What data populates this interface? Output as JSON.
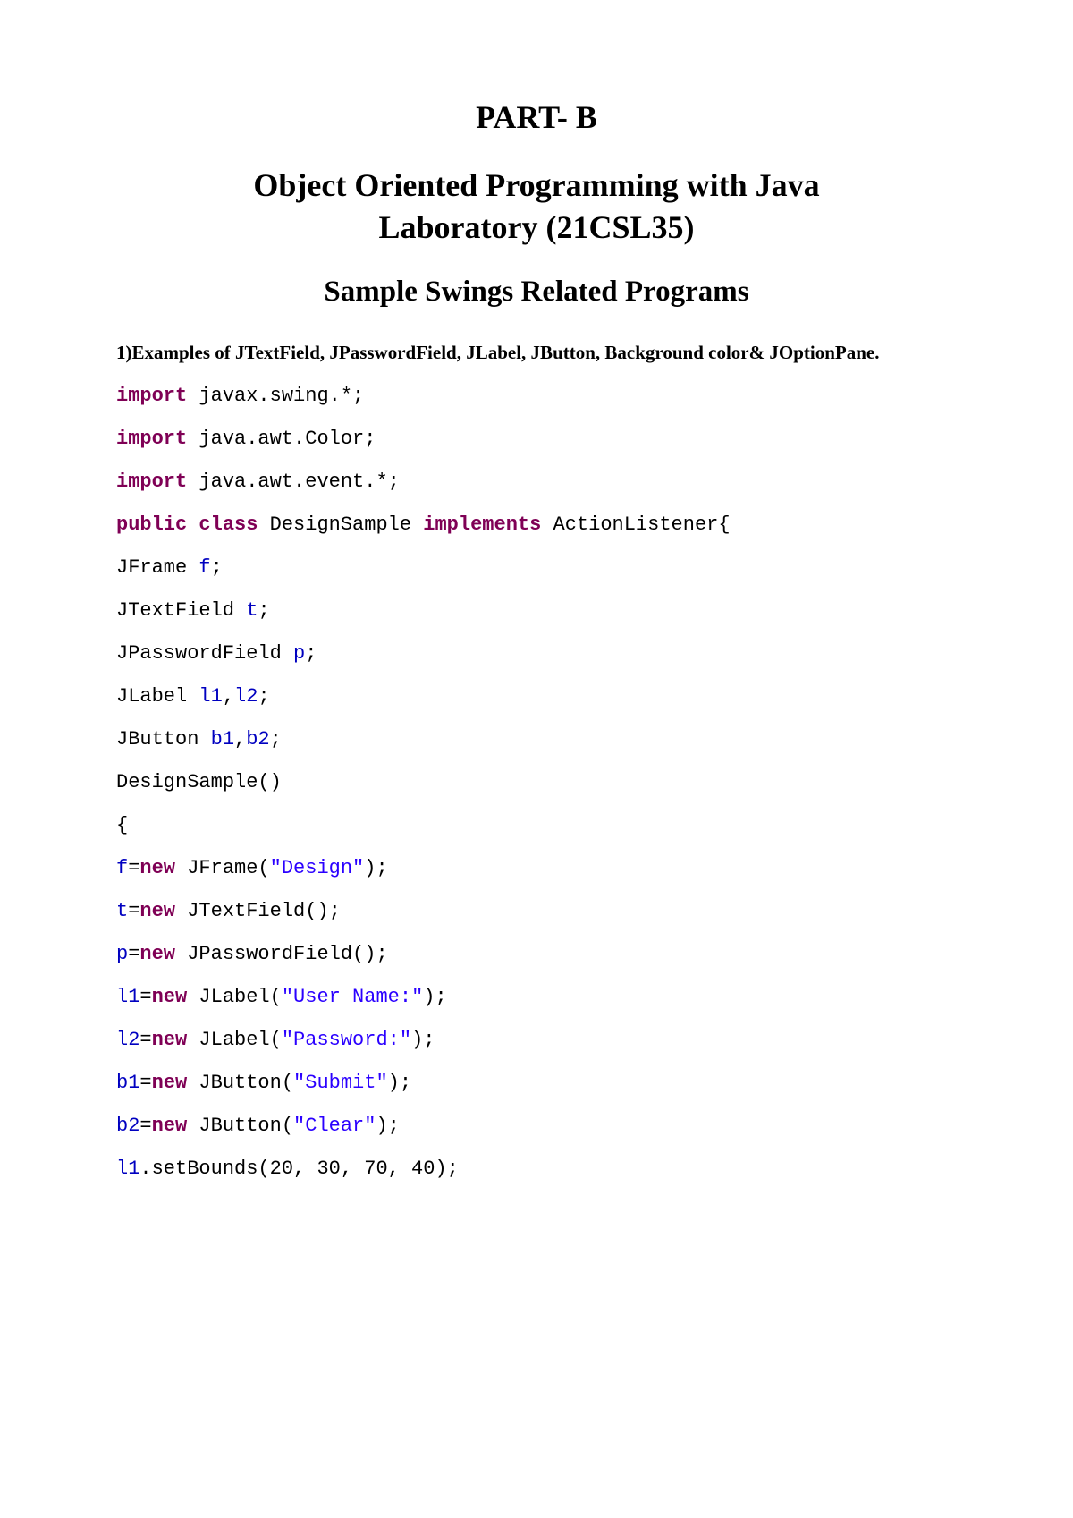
{
  "headings": {
    "part": "PART- B",
    "title_line1": "Object Oriented Programming with Java",
    "title_line2": "Laboratory (21CSL35)",
    "subtitle": "Sample Swings Related Programs"
  },
  "paragraph": {
    "label": "1)Examples of JTextField, JPasswordField, JLabel, JButton, Background color& JOptionPane."
  },
  "code": {
    "lines": [
      [
        {
          "t": "import",
          "c": "kw"
        },
        {
          "t": " javax.swing.*;",
          "c": "plain"
        }
      ],
      [
        {
          "t": "import",
          "c": "kw"
        },
        {
          "t": " java.awt.Color;",
          "c": "plain"
        }
      ],
      [
        {
          "t": "import",
          "c": "kw"
        },
        {
          "t": " java.awt.event.*;",
          "c": "plain"
        }
      ],
      [
        {
          "t": "public",
          "c": "kw"
        },
        {
          "t": " ",
          "c": "plain"
        },
        {
          "t": "class",
          "c": "kw"
        },
        {
          "t": " DesignSample ",
          "c": "plain"
        },
        {
          "t": "implements",
          "c": "kw"
        },
        {
          "t": " ActionListener{",
          "c": "plain"
        }
      ],
      [
        {
          "t": "JFrame ",
          "c": "plain"
        },
        {
          "t": "f",
          "c": "var"
        },
        {
          "t": ";",
          "c": "plain"
        }
      ],
      [
        {
          "t": "JTextField ",
          "c": "plain"
        },
        {
          "t": "t",
          "c": "var"
        },
        {
          "t": ";",
          "c": "plain"
        }
      ],
      [
        {
          "t": "JPasswordField ",
          "c": "plain"
        },
        {
          "t": "p",
          "c": "var"
        },
        {
          "t": ";",
          "c": "plain"
        }
      ],
      [
        {
          "t": "JLabel ",
          "c": "plain"
        },
        {
          "t": "l1",
          "c": "var"
        },
        {
          "t": ",",
          "c": "plain"
        },
        {
          "t": "l2",
          "c": "var"
        },
        {
          "t": ";",
          "c": "plain"
        }
      ],
      [
        {
          "t": "JButton ",
          "c": "plain"
        },
        {
          "t": "b1",
          "c": "var"
        },
        {
          "t": ",",
          "c": "plain"
        },
        {
          "t": "b2",
          "c": "var"
        },
        {
          "t": ";",
          "c": "plain"
        }
      ],
      [
        {
          "t": "DesignSample()",
          "c": "plain"
        }
      ],
      [
        {
          "t": "{",
          "c": "plain"
        }
      ],
      [
        {
          "t": "f",
          "c": "var"
        },
        {
          "t": "=",
          "c": "plain"
        },
        {
          "t": "new",
          "c": "kw"
        },
        {
          "t": " JFrame(",
          "c": "plain"
        },
        {
          "t": "\"Design\"",
          "c": "str"
        },
        {
          "t": ");",
          "c": "plain"
        }
      ],
      [
        {
          "t": "t",
          "c": "var"
        },
        {
          "t": "=",
          "c": "plain"
        },
        {
          "t": "new",
          "c": "kw"
        },
        {
          "t": " JTextField();",
          "c": "plain"
        }
      ],
      [
        {
          "t": "p",
          "c": "var"
        },
        {
          "t": "=",
          "c": "plain"
        },
        {
          "t": "new",
          "c": "kw"
        },
        {
          "t": " JPasswordField();",
          "c": "plain"
        }
      ],
      [
        {
          "t": "l1",
          "c": "var"
        },
        {
          "t": "=",
          "c": "plain"
        },
        {
          "t": "new",
          "c": "kw"
        },
        {
          "t": " JLabel(",
          "c": "plain"
        },
        {
          "t": "\"User Name:\"",
          "c": "str"
        },
        {
          "t": ");",
          "c": "plain"
        }
      ],
      [
        {
          "t": "l2",
          "c": "var"
        },
        {
          "t": "=",
          "c": "plain"
        },
        {
          "t": "new",
          "c": "kw"
        },
        {
          "t": " JLabel(",
          "c": "plain"
        },
        {
          "t": "\"Password:\"",
          "c": "str"
        },
        {
          "t": ");",
          "c": "plain"
        }
      ],
      [
        {
          "t": "b1",
          "c": "var"
        },
        {
          "t": "=",
          "c": "plain"
        },
        {
          "t": "new",
          "c": "kw"
        },
        {
          "t": " JButton(",
          "c": "plain"
        },
        {
          "t": "\"Submit\"",
          "c": "str"
        },
        {
          "t": ");",
          "c": "plain"
        }
      ],
      [
        {
          "t": "b2",
          "c": "var"
        },
        {
          "t": "=",
          "c": "plain"
        },
        {
          "t": "new",
          "c": "kw"
        },
        {
          "t": " JButton(",
          "c": "plain"
        },
        {
          "t": "\"Clear\"",
          "c": "str"
        },
        {
          "t": ");",
          "c": "plain"
        }
      ],
      [
        {
          "t": "l1",
          "c": "var"
        },
        {
          "t": ".setBounds(20, 30, 70, 40);",
          "c": "plain"
        }
      ]
    ]
  }
}
